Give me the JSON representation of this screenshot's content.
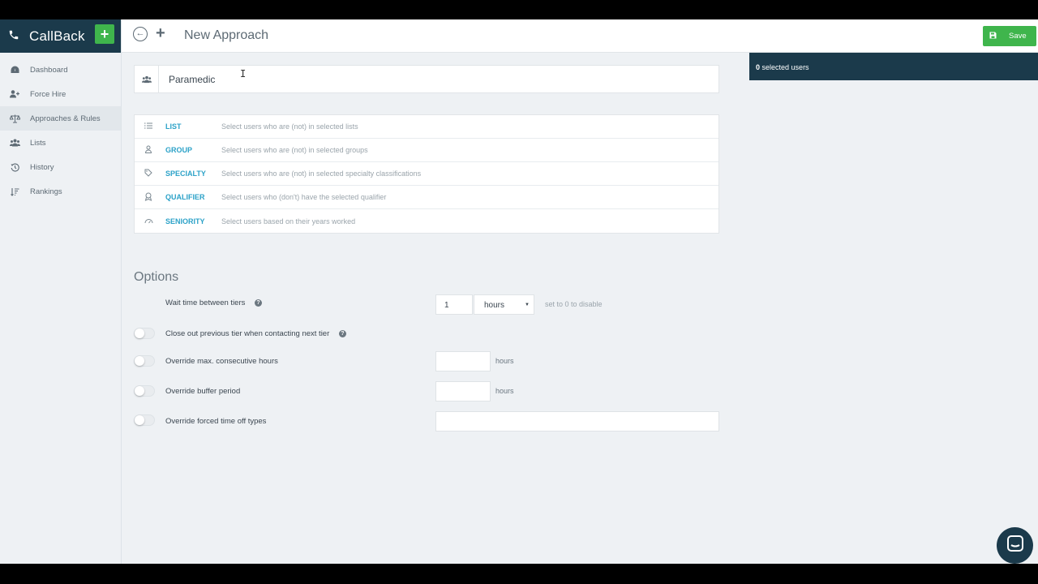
{
  "app": {
    "name": "CallBack"
  },
  "sidebar": {
    "items": [
      {
        "label": "Dashboard",
        "icon": "dashboard-icon"
      },
      {
        "label": "Force Hire",
        "icon": "user-plus-icon"
      },
      {
        "label": "Approaches & Rules",
        "icon": "balance-scale-icon",
        "active": true
      },
      {
        "label": "Lists",
        "icon": "users-icon"
      },
      {
        "label": "History",
        "icon": "history-icon"
      },
      {
        "label": "Rankings",
        "icon": "sort-icon"
      }
    ]
  },
  "header": {
    "title": "New Approach",
    "save_label": "Save"
  },
  "approach": {
    "name_value": "Paramedic"
  },
  "rules": [
    {
      "name": "LIST",
      "description": "Select users who are (not) in selected lists",
      "icon": "list-icon"
    },
    {
      "name": "GROUP",
      "description": "Select users who are (not) in selected groups",
      "icon": "group-icon"
    },
    {
      "name": "SPECIALTY",
      "description": "Select users who are (not) in selected specialty classifications",
      "icon": "tag-icon"
    },
    {
      "name": "QUALIFIER",
      "description": "Select users who (don't) have the selected qualifier",
      "icon": "ribbon-icon"
    },
    {
      "name": "SENIORITY",
      "description": "Select users based on their years worked",
      "icon": "gauge-icon"
    }
  ],
  "options": {
    "title": "Options",
    "wait_time": {
      "label": "Wait time between tiers",
      "value": "1",
      "unit_selected": "hours",
      "hint": "set to 0 to disable"
    },
    "close_out": {
      "label": "Close out previous tier when contacting next tier"
    },
    "max_hours": {
      "label": "Override max. consecutive hours",
      "unit": "hours"
    },
    "buffer": {
      "label": "Override buffer period",
      "unit": "hours"
    },
    "time_off": {
      "label": "Override forced time off types"
    }
  },
  "selection": {
    "count": "0",
    "label": "selected users"
  },
  "colors": {
    "navy": "#1b3a4b",
    "green": "#3fb54c",
    "link": "#2ca2c8"
  }
}
